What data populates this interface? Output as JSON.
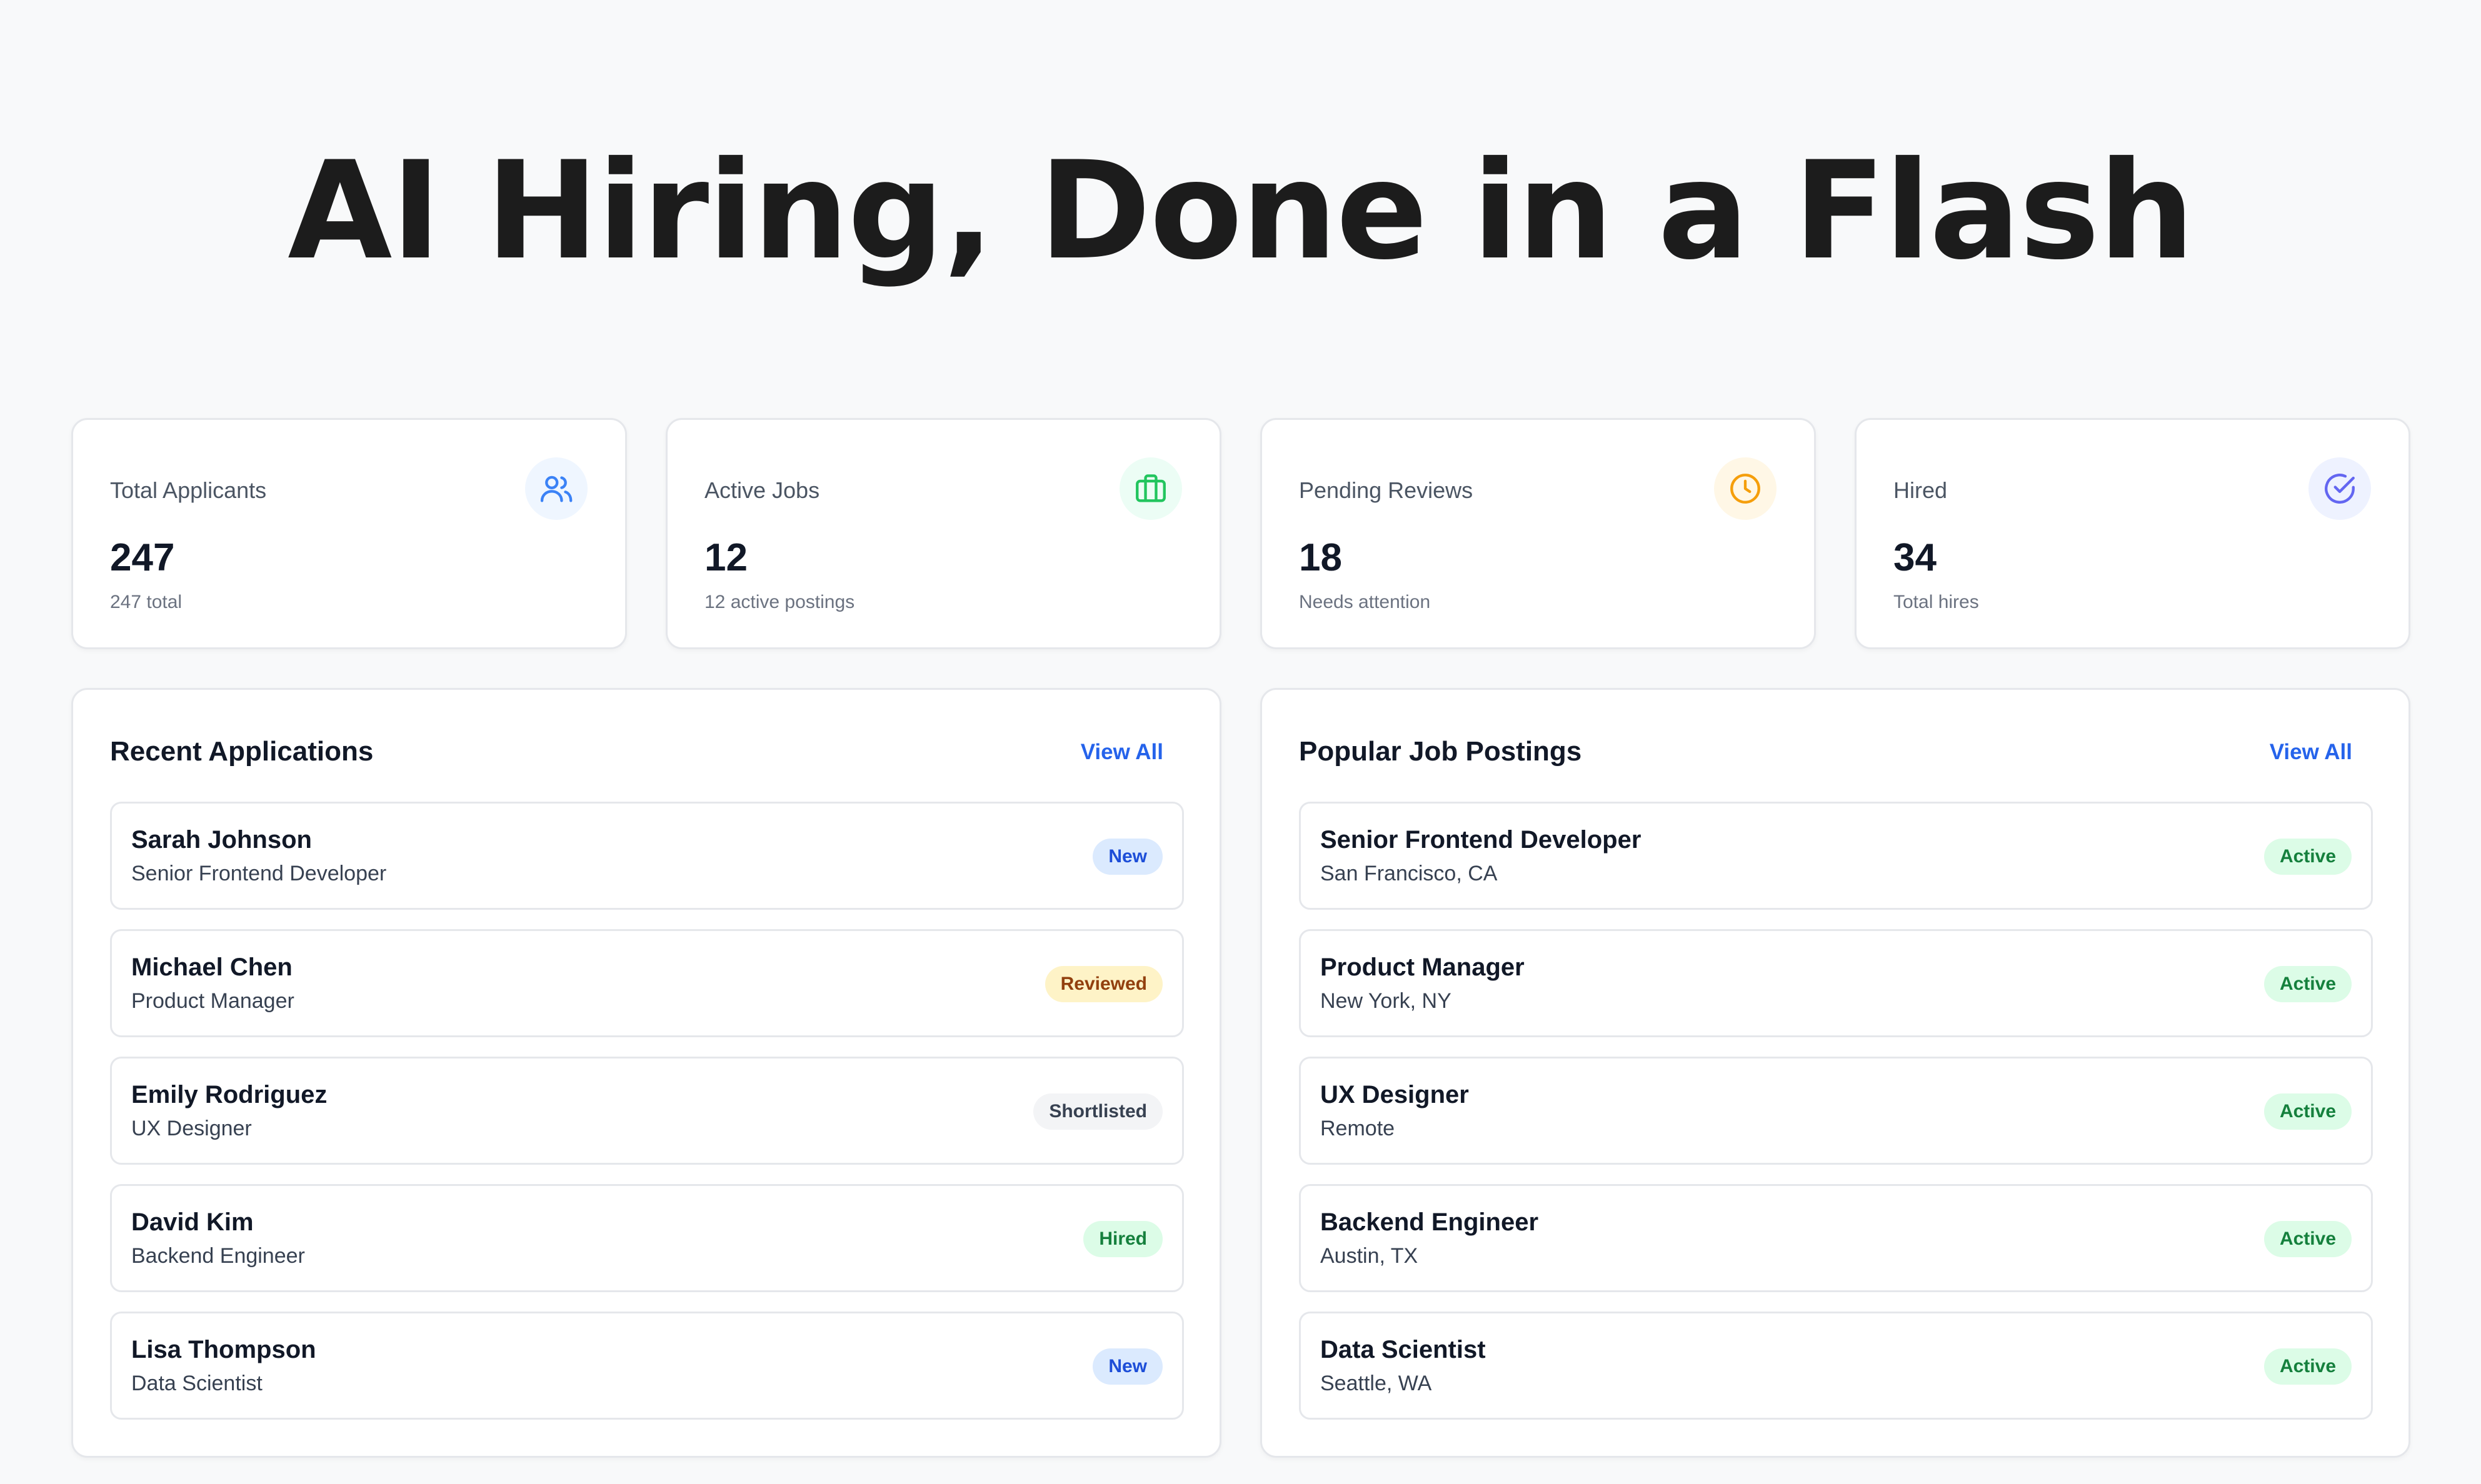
{
  "hero": {
    "title": "AI Hiring, Done in a Flash"
  },
  "stats": [
    {
      "label": "Total Applicants",
      "value": "247",
      "sub": "247 total",
      "icon": "users-icon",
      "color": "#3b82f6",
      "bg": "#eff6ff"
    },
    {
      "label": "Active Jobs",
      "value": "12",
      "sub": "12 active postings",
      "icon": "briefcase-icon",
      "color": "#22c55e",
      "bg": "#ecfdf5"
    },
    {
      "label": "Pending Reviews",
      "value": "18",
      "sub": "Needs attention",
      "icon": "clock-icon",
      "color": "#f59e0b",
      "bg": "#fff7e6"
    },
    {
      "label": "Hired",
      "value": "34",
      "sub": "Total hires",
      "icon": "check-circle-icon",
      "color": "#6366f1",
      "bg": "#eef2ff"
    }
  ],
  "recent_applications": {
    "title": "Recent Applications",
    "view_all": "View All",
    "items": [
      {
        "name": "Sarah Johnson",
        "role": "Senior Frontend Developer",
        "status": "New",
        "status_type": "new"
      },
      {
        "name": "Michael Chen",
        "role": "Product Manager",
        "status": "Reviewed",
        "status_type": "reviewed"
      },
      {
        "name": "Emily Rodriguez",
        "role": "UX Designer",
        "status": "Shortlisted",
        "status_type": "shortlisted"
      },
      {
        "name": "David Kim",
        "role": "Backend Engineer",
        "status": "Hired",
        "status_type": "hired"
      },
      {
        "name": "Lisa Thompson",
        "role": "Data Scientist",
        "status": "New",
        "status_type": "new"
      }
    ]
  },
  "popular_jobs": {
    "title": "Popular Job Postings",
    "view_all": "View All",
    "items": [
      {
        "title": "Senior Frontend Developer",
        "location": "San Francisco, CA",
        "status": "Active"
      },
      {
        "title": "Product Manager",
        "location": "New York, NY",
        "status": "Active"
      },
      {
        "title": "UX Designer",
        "location": "Remote",
        "status": "Active"
      },
      {
        "title": "Backend Engineer",
        "location": "Austin, TX",
        "status": "Active"
      },
      {
        "title": "Data Scientist",
        "location": "Seattle, WA",
        "status": "Active"
      }
    ]
  }
}
